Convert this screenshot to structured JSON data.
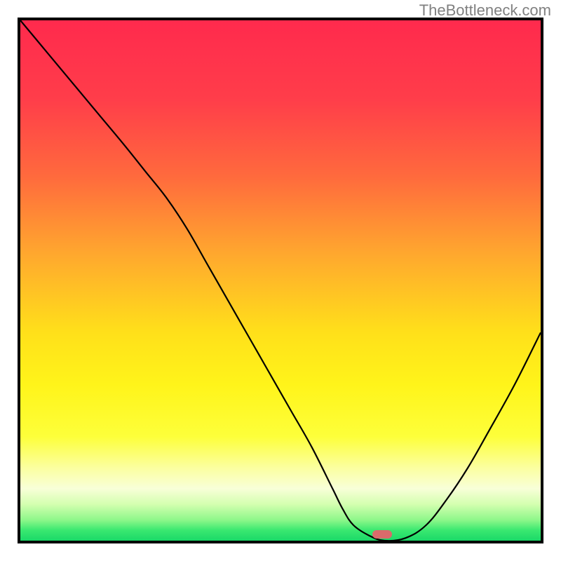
{
  "watermark": "TheBottleneck.com",
  "chart_data": {
    "type": "line",
    "title": "",
    "xlabel": "",
    "ylabel": "",
    "xlim": [
      0,
      100
    ],
    "ylim": [
      0,
      100
    ],
    "series": [
      {
        "name": "bottleneck-curve",
        "x": [
          0,
          5,
          10,
          15,
          20,
          24,
          28,
          32,
          36,
          40,
          44,
          48,
          52,
          56,
          60,
          62,
          64,
          67,
          70,
          74,
          78,
          82,
          86,
          90,
          95,
          100
        ],
        "y": [
          100,
          94,
          88,
          82,
          76,
          71,
          66,
          60,
          53,
          46,
          39,
          32,
          25,
          18,
          10,
          6,
          3,
          1,
          0,
          0.5,
          3,
          8,
          14,
          21,
          30,
          40
        ]
      }
    ],
    "marker": {
      "x": 69.5,
      "y": 0.5
    },
    "gradient_stops": [
      {
        "offset": 0,
        "color": "#ff2a4d"
      },
      {
        "offset": 15,
        "color": "#ff3d4a"
      },
      {
        "offset": 30,
        "color": "#ff6a3d"
      },
      {
        "offset": 45,
        "color": "#ffa82e"
      },
      {
        "offset": 60,
        "color": "#ffe01a"
      },
      {
        "offset": 70,
        "color": "#fff41a"
      },
      {
        "offset": 80,
        "color": "#fdff3a"
      },
      {
        "offset": 86,
        "color": "#fbffa0"
      },
      {
        "offset": 90,
        "color": "#f8ffd8"
      },
      {
        "offset": 93,
        "color": "#d4ffb0"
      },
      {
        "offset": 96,
        "color": "#8ef78a"
      },
      {
        "offset": 98,
        "color": "#3ae870"
      },
      {
        "offset": 100,
        "color": "#1ad968"
      }
    ]
  }
}
